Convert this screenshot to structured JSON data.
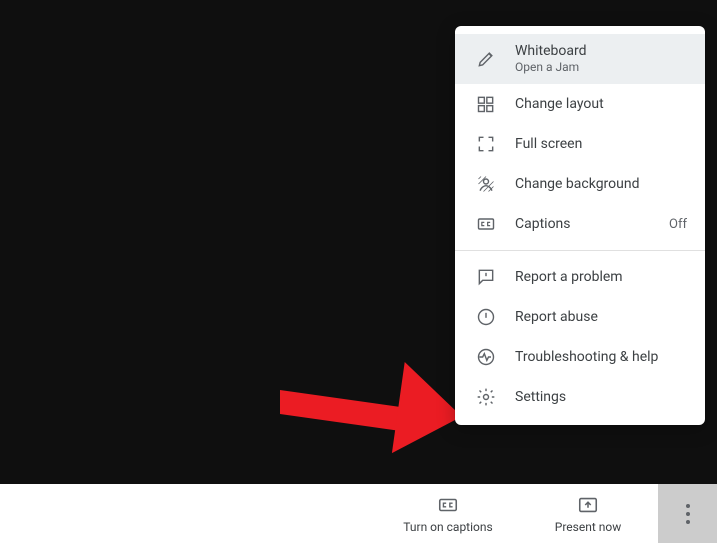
{
  "menu": {
    "whiteboard": {
      "label": "Whiteboard",
      "sub": "Open a Jam"
    },
    "change_layout": "Change layout",
    "full_screen": "Full screen",
    "change_background": "Change background",
    "captions": {
      "label": "Captions",
      "status": "Off"
    },
    "report_problem": "Report a problem",
    "report_abuse": "Report abuse",
    "troubleshooting": "Troubleshooting & help",
    "settings": "Settings"
  },
  "toolbar": {
    "captions": "Turn on captions",
    "present": "Present now"
  }
}
